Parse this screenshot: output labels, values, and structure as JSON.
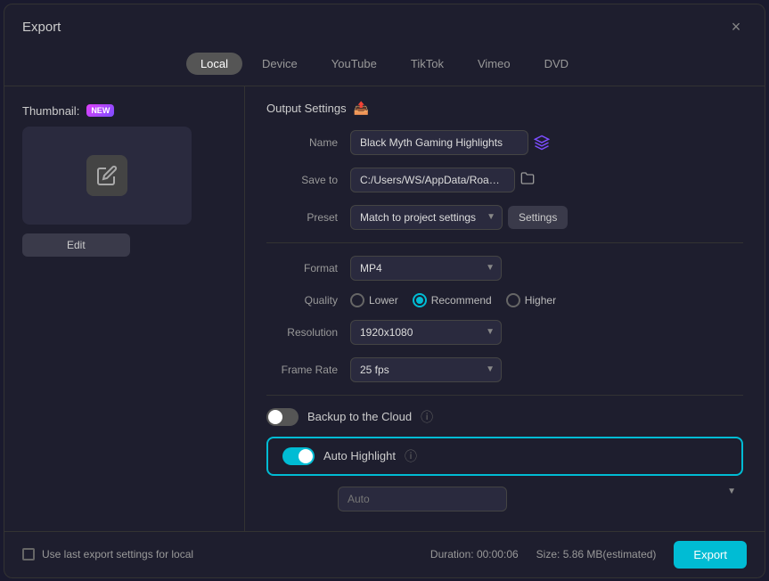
{
  "dialog": {
    "title": "Export",
    "close_label": "×"
  },
  "tabs": [
    {
      "id": "local",
      "label": "Local",
      "active": true
    },
    {
      "id": "device",
      "label": "Device",
      "active": false
    },
    {
      "id": "youtube",
      "label": "YouTube",
      "active": false
    },
    {
      "id": "tiktok",
      "label": "TikTok",
      "active": false
    },
    {
      "id": "vimeo",
      "label": "Vimeo",
      "active": false
    },
    {
      "id": "dvd",
      "label": "DVD",
      "active": false
    }
  ],
  "thumbnail": {
    "label": "Thumbnail:",
    "badge": "NEW",
    "edit_btn": "Edit"
  },
  "output_settings": {
    "section_title": "Output Settings",
    "name_label": "Name",
    "name_value": "Black Myth Gaming Highlights",
    "save_to_label": "Save to",
    "save_to_value": "C:/Users/WS/AppData/Roami...",
    "preset_label": "Preset",
    "preset_value": "Match to project settings",
    "settings_btn": "Settings",
    "format_label": "Format",
    "format_value": "MP4",
    "quality_label": "Quality",
    "quality_options": [
      {
        "id": "lower",
        "label": "Lower",
        "checked": false
      },
      {
        "id": "recommend",
        "label": "Recommend",
        "checked": true
      },
      {
        "id": "higher",
        "label": "Higher",
        "checked": false
      }
    ],
    "resolution_label": "Resolution",
    "resolution_value": "1920x1080",
    "framerate_label": "Frame Rate",
    "framerate_value": "25 fps",
    "backup_label": "Backup to the Cloud",
    "auto_highlight_label": "Auto Highlight",
    "auto_value": "Auto"
  },
  "footer": {
    "checkbox_label": "Use last export settings for local",
    "duration_label": "Duration:",
    "duration_value": "00:00:06",
    "size_label": "Size:",
    "size_value": "5.86 MB(estimated)",
    "export_btn": "Export"
  }
}
